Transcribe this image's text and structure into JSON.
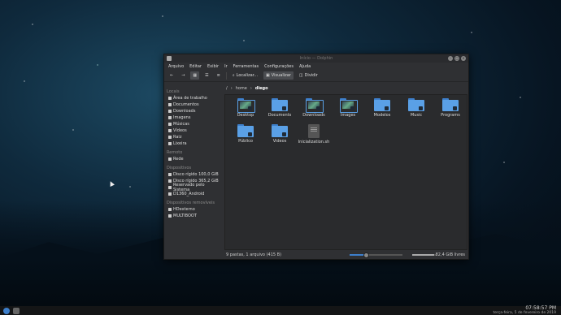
{
  "window": {
    "title": "Início — Dolphin",
    "menu": [
      "Arquivo",
      "Editar",
      "Exibir",
      "Ir",
      "Ferramentas",
      "Configurações",
      "Ajuda"
    ],
    "toolbar": {
      "locate_label": "Localizar...",
      "preview_label": "Visualizar",
      "split_label": "Dividir"
    },
    "breadcrumb": [
      "/",
      "home",
      "diego"
    ]
  },
  "sidebar": {
    "sections": [
      {
        "title": "Locais",
        "items": [
          "Área de trabalho",
          "Documentos",
          "Downloads",
          "Imagens",
          "Músicas",
          "Vídeos",
          "Raiz",
          "Lixeira"
        ]
      },
      {
        "title": "Remoto",
        "items": [
          "Rede"
        ]
      },
      {
        "title": "Dispositivos",
        "items": [
          "Disco rígido 100,0 GiB",
          "Disco rígido 365,2 GiB",
          "Reservado pelo Sistema",
          "D1360_Android"
        ]
      },
      {
        "title": "Dispositivos removíveis",
        "items": [
          "HDexterno",
          "MULTIBOOT"
        ]
      }
    ]
  },
  "files": [
    {
      "name": "Desktop",
      "kind": "thumb"
    },
    {
      "name": "Documents",
      "kind": "folder"
    },
    {
      "name": "Downloads",
      "kind": "thumb"
    },
    {
      "name": "Images",
      "kind": "thumb"
    },
    {
      "name": "Modelos",
      "kind": "folder"
    },
    {
      "name": "Music",
      "kind": "folder"
    },
    {
      "name": "Programs",
      "kind": "folder"
    },
    {
      "name": "Público",
      "kind": "folder"
    },
    {
      "name": "Videos",
      "kind": "folder"
    },
    {
      "name": "Inicialization.sh",
      "kind": "file"
    }
  ],
  "status": {
    "text": "9 pastas, 1 arquivo (415 B)",
    "free": "82,4 GiB livres",
    "zoom_fraction": 0.3,
    "free_fraction": 0.9
  },
  "taskbar": {
    "time": "07:58:57 PM",
    "date": "terça-feira, 5 de fevereiro de 2019"
  },
  "colors": {
    "folder": "#5aa0e6",
    "accent": "#3d7fcb"
  }
}
